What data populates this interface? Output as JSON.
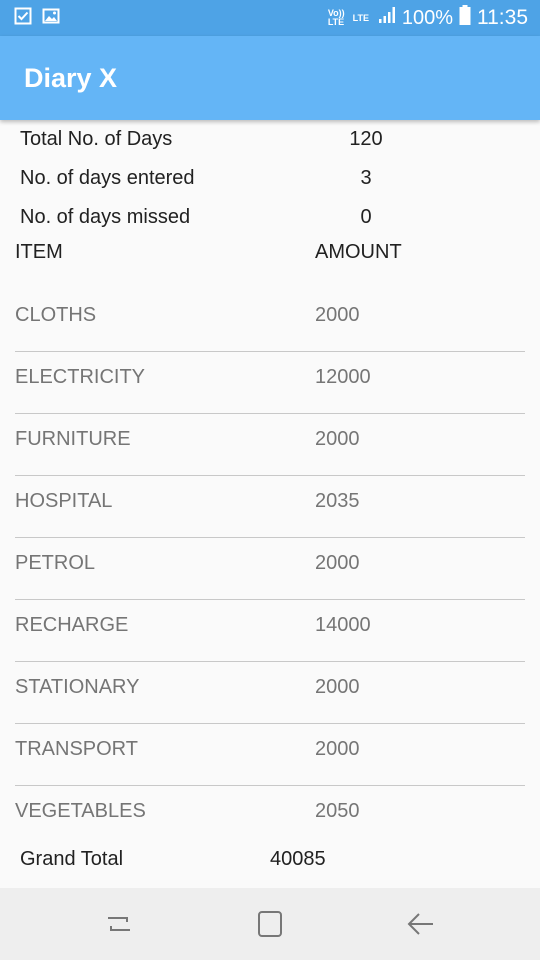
{
  "status_bar": {
    "volte": "Vo)) LTE",
    "lte": "LTE",
    "battery": "100%",
    "time": "11:35"
  },
  "app_bar": {
    "title": "Diary X"
  },
  "summary": [
    {
      "label": "Total No. of Days",
      "value": "120"
    },
    {
      "label": "No. of days entered",
      "value": "3"
    },
    {
      "label": "No. of days missed",
      "value": "0"
    }
  ],
  "table": {
    "headers": {
      "item": "ITEM",
      "amount": "AMOUNT"
    },
    "rows": [
      {
        "item": "CLOTHS",
        "amount": "2000"
      },
      {
        "item": "ELECTRICITY",
        "amount": "12000"
      },
      {
        "item": "FURNITURE",
        "amount": "2000"
      },
      {
        "item": "HOSPITAL",
        "amount": "2035"
      },
      {
        "item": "PETROL",
        "amount": "2000"
      },
      {
        "item": "RECHARGE",
        "amount": "14000"
      },
      {
        "item": "STATIONARY",
        "amount": "2000"
      },
      {
        "item": "TRANSPORT",
        "amount": "2000"
      },
      {
        "item": "VEGETABLES",
        "amount": "2050"
      }
    ]
  },
  "grand_total": {
    "label": "Grand Total",
    "value": "40085"
  },
  "colors": {
    "status_bar": "#4ea3e6",
    "app_bar": "#64b5f6",
    "background": "#fafafa",
    "nav_bar": "#eeeeee"
  },
  "icons": {
    "status_left": [
      "checkbox-notification-icon",
      "image-notification-icon"
    ],
    "status_right": [
      "signal-icon",
      "battery-icon"
    ],
    "nav": [
      "recent-apps-icon",
      "home-icon",
      "back-icon"
    ]
  }
}
